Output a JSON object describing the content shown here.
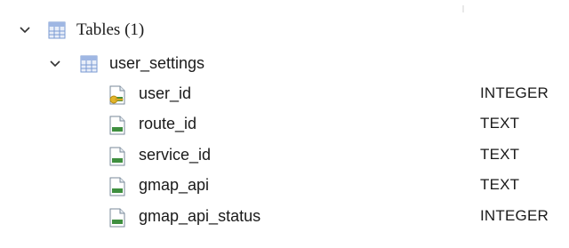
{
  "tree": {
    "root": {
      "label": "Tables (1)"
    },
    "table": {
      "label": "user_settings",
      "fields": [
        {
          "name": "user_id",
          "type": "INTEGER",
          "icon": "key-field-icon"
        },
        {
          "name": "route_id",
          "type": "TEXT",
          "icon": "field-icon"
        },
        {
          "name": "service_id",
          "type": "TEXT",
          "icon": "field-icon"
        },
        {
          "name": "gmap_api",
          "type": "TEXT",
          "icon": "field-icon"
        },
        {
          "name": "gmap_api_status",
          "type": "INTEGER",
          "icon": "field-icon"
        }
      ]
    }
  },
  "colors": {
    "text": "#1a1a1a",
    "chevron": "#333333",
    "table_icon_blue": "#7a9ad2",
    "field_icon_green": "#3f8f3f",
    "key_icon_gold": "#e2b52a"
  }
}
